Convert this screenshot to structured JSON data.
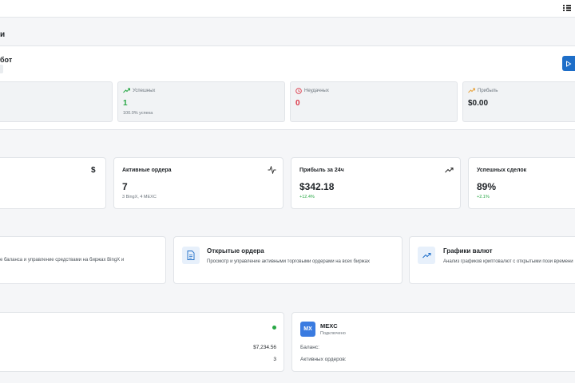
{
  "header": {
    "menu_icon": "grid-icon"
  },
  "page": {
    "title": "и"
  },
  "bot": {
    "title": "бот"
  },
  "stats": [
    {
      "label": "",
      "value": "",
      "sub": ""
    },
    {
      "label": "Успешных",
      "value": "1",
      "sub": "100.0% успеха",
      "color": "#28a745",
      "icon": "trend-up-icon"
    },
    {
      "label": "Неудачных",
      "value": "0",
      "sub": "",
      "color": "#dc3545",
      "icon": "clock-icon"
    },
    {
      "label": "Прибыль",
      "value": "$0.00",
      "sub": "",
      "color": "#212529",
      "icon": "trend-up-icon"
    }
  ],
  "metrics": [
    {
      "title": "",
      "value": "",
      "sub": "",
      "icon": "$"
    },
    {
      "title": "Активные ордера",
      "value": "7",
      "sub": "3 BingX, 4 MEXC"
    },
    {
      "title": "Прибыль за 24ч",
      "value": "$342.18",
      "sub": "+12.4%"
    },
    {
      "title": "Успешных сделок",
      "value": "89%",
      "sub": "+2.1%"
    }
  ],
  "features": [
    {
      "title": "",
      "desc": "е баланса и управление средствами на биржах BingX и"
    },
    {
      "title": "Открытые ордера",
      "desc": "Просмотр и управление активными торговыми ордерами на всех биржах"
    },
    {
      "title": "Графики валют",
      "desc": "Анализ графиков криптовалют с открытыми пози времени"
    }
  ],
  "exchanges": {
    "left": {
      "balance": "$7,234.56",
      "orders": "3"
    },
    "right": {
      "logo": "MX",
      "name": "MEXC",
      "status": "Подключено",
      "balance_label": "Баланс:",
      "orders_label": "Активных ордеров:"
    }
  },
  "colors": {
    "accent": "#1e6ec8",
    "success": "#28a745",
    "danger": "#dc3545"
  }
}
